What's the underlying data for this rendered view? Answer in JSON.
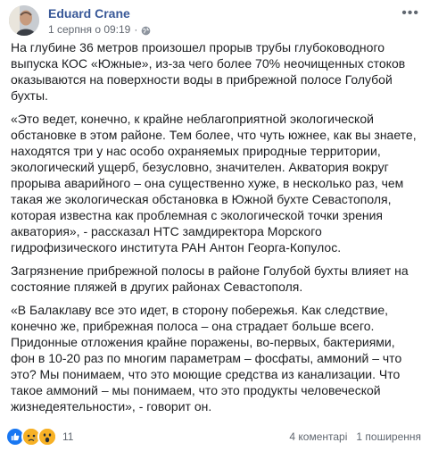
{
  "post": {
    "author": "Eduard Crane",
    "timestamp": "1 серпня о 09:19",
    "paragraphs": [
      "На глубине 36 метров произошел прорыв трубы глубоководного выпуска КОС «Южные», из-за чего более 70% неочищенных стоков оказываются на поверхности воды в прибрежной полосе Голубой бухты.",
      "«Это ведет, конечно, к крайне неблагоприятной экологической обстановке в этом районе. Тем более, что чуть южнее, как вы знаете, находятся три у нас особо охраняемых природные территории, экологический ущерб, безусловно, значителен. Акватория вокруг прорыва аварийного – она существенно хуже, в несколько раз, чем такая же экологическая обстановка в Южной бухте Севастополя, которая известна как проблемная с экологической точки зрения акватория», - рассказал НТС замдиректора Морского гидрофизического института РАН Антон Георга-Копулос.",
      "Загрязнение прибрежной полосы в районе Голубой бухты влияет на состояние пляжей в других районах Севастополя.",
      "«В Балаклаву все это идет, в сторону побережья. Как следствие, конечно же, прибрежная полоса – она страдает больше всего. Придонные отложения крайне поражены, во-первых, бактериями, фон в 10-20 раз по многим параметрам – фосфаты, аммоний – что это? Мы понимаем, что это моющие средства из канализации. Что такое аммоний – мы понимаем, что это продукты человеческой жизнедеятельности», - говорит он."
    ]
  },
  "footer": {
    "reaction_count": "11",
    "comments": "4 коментарі",
    "shares": "1 поширення"
  },
  "colors": {
    "author_link": "#385898",
    "text": "#1c1e21",
    "muted": "#606770",
    "like_blue": "#1877f2",
    "emoji_yellow": "#f7b125"
  },
  "icons": [
    "avatar",
    "globe-icon",
    "more-options-icon",
    "like-reaction-icon",
    "sad-reaction-icon",
    "wow-reaction-icon"
  ]
}
